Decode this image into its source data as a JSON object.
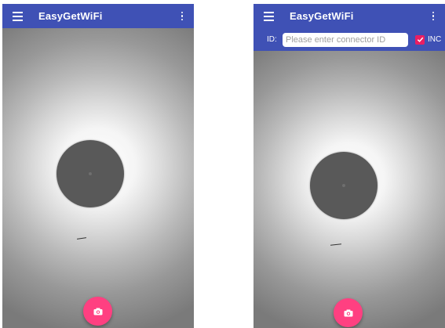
{
  "screens": [
    {
      "app_title": "EasyGetWiFi",
      "icons": {
        "menu": "menu-icon",
        "overflow": "more-vert-icon",
        "fab": "camera-icon"
      }
    },
    {
      "app_title": "EasyGetWiFi",
      "id_label": "ID:",
      "id_input_placeholder": "Please enter connector ID",
      "id_input_value": "",
      "inc_label": "INC",
      "inc_checked": true,
      "icons": {
        "menu": "menu-icon",
        "overflow": "more-vert-icon",
        "fab": "camera-icon",
        "checkbox": "check-icon"
      }
    }
  ],
  "colors": {
    "appbar": "#3f51b5",
    "accent": "#ff4081",
    "checkbox": "#e91e63",
    "fiber_core": "#595959"
  }
}
